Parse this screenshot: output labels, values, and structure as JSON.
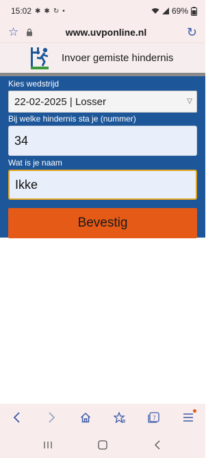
{
  "status_bar": {
    "time": "15:02",
    "notification_icons": [
      "maple-leaf-icon",
      "maple-leaf-icon",
      "sync-icon",
      "dot-icon"
    ],
    "battery": "69%"
  },
  "browser": {
    "url": "www.uvponline.nl",
    "tab_count": "7"
  },
  "header": {
    "title": "Invoer gemiste hindernis"
  },
  "form": {
    "competition_label": "Kies wedstrijd",
    "competition_value": "22-02-2025 | Losser",
    "obstacle_label": "Bij welke hindernis sta je (nummer)",
    "obstacle_value": "34",
    "name_label": "Wat is je naam",
    "name_value": "Ikke",
    "confirm_label": "Bevestig"
  },
  "colors": {
    "panel": "#1e5799",
    "button": "#e55a17",
    "focus_border": "#e2a520"
  }
}
